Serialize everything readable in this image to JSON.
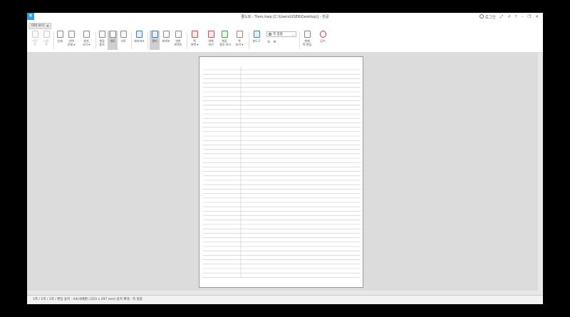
{
  "window": {
    "title": "줄노트 - Trem.hwp [C:\\Users\\USER\\Desktop\\] - 한글",
    "login_label": "로그인",
    "controls": [
      "⤢",
      "↗",
      "?",
      "–",
      "❐",
      "✕"
    ]
  },
  "tab": {
    "label": "미리 보기",
    "close": "×"
  },
  "ribbon": {
    "buttons": [
      {
        "label": "이전\n쪽"
      },
      {
        "label": "다음\n쪽"
      },
      {
        "label": "인쇄"
      },
      {
        "label": "선택\n인쇄 ▾"
      },
      {
        "label": "용지\n크기 ▾"
      },
      {
        "label": "편집\n용지"
      },
      {
        "label": "세로"
      },
      {
        "label": "가로"
      },
      {
        "label": "워터마크"
      },
      {
        "label": "컬러"
      },
      {
        "label": "회색조"
      },
      {
        "label": "연한\n회색조"
      },
      {
        "label": "쪽\n여백 ▾"
      },
      {
        "label": "여백\n보기"
      },
      {
        "label": "편집\n용지 보기"
      },
      {
        "label": "쪽\n보기 ▾"
      },
      {
        "label": "손도구"
      },
      {
        "label": "현재\n쪽 편집"
      },
      {
        "label": "닫기"
      }
    ],
    "zoom_value": "쪽 맞춤"
  },
  "status": {
    "text": "1쪽 / 1쪽 / 1쪽 / 편집 용지 : A4(국배판)  [210 x 297 mm]  용지 확대 : 쪽 맞춤"
  },
  "colors": {
    "accent": "#2aa0e6",
    "workspace": "#dcdcdc",
    "rule_line": "#c9c9c9"
  }
}
